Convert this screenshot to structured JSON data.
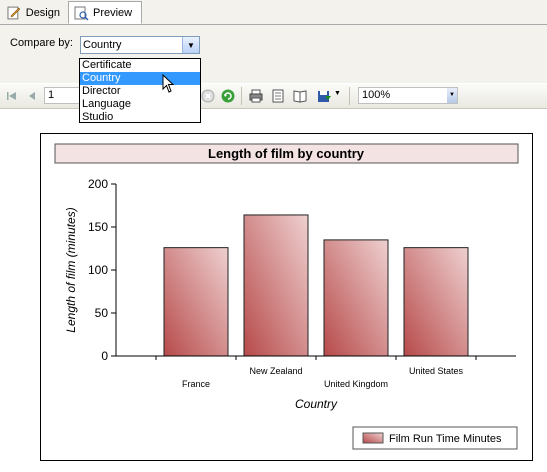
{
  "tabs": {
    "design_label": "Design",
    "preview_label": "Preview"
  },
  "parameters": {
    "compare_by_label": "Compare by:",
    "compare_by_value": "Country",
    "options": [
      "Certificate",
      "Country",
      "Director",
      "Language",
      "Studio"
    ],
    "selected_index": 1
  },
  "toolbar": {
    "page_number": "1",
    "zoom": "100%"
  },
  "colors": {
    "bar_fill_dark": "#b74a4a",
    "bar_fill_light": "#efd0d0",
    "title_bg": "#f4e3e3"
  },
  "chart_data": {
    "type": "bar",
    "title": "Length of film by country",
    "xlabel": "Country",
    "ylabel": "Length of film (minutes)",
    "categories": [
      "France",
      "New Zealand",
      "United Kingdom",
      "United States"
    ],
    "series": [
      {
        "name": "Film Run Time Minutes",
        "values": [
          126,
          164,
          135,
          126
        ]
      }
    ],
    "ylim": [
      0,
      200
    ],
    "yticks": [
      0,
      50,
      100,
      150,
      200
    ],
    "grid": false,
    "legend": "bottom-right"
  }
}
